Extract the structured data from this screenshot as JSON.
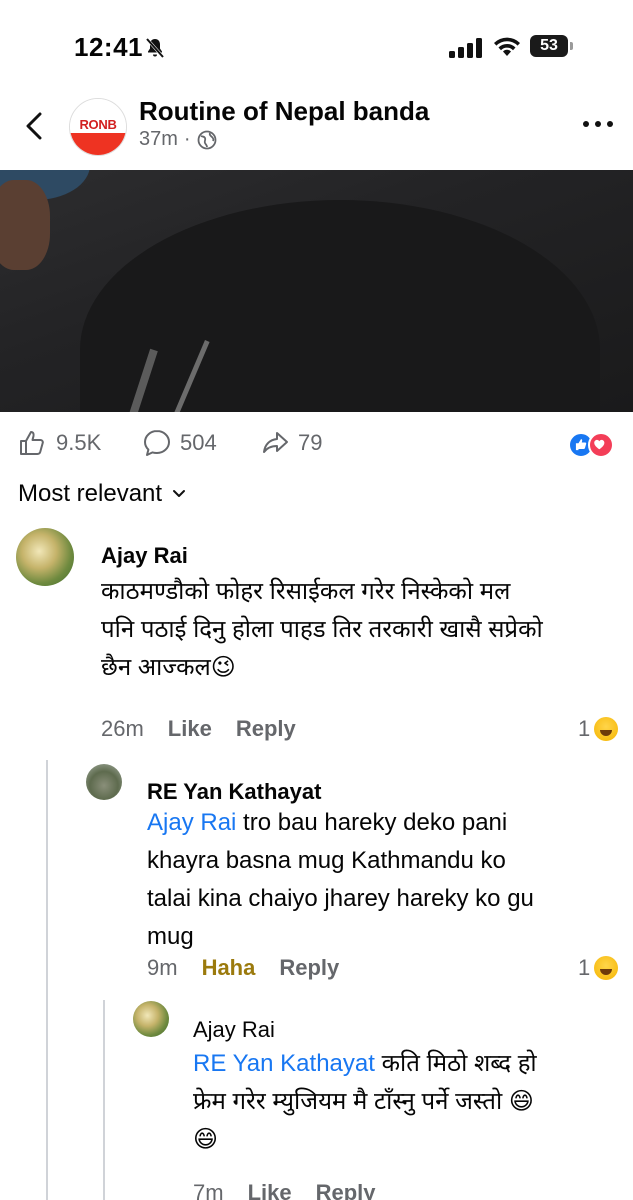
{
  "status_bar": {
    "time": "12:41",
    "battery": "53"
  },
  "header": {
    "title": "Routine of Nepal banda",
    "time_ago": "37m",
    "separator": "·",
    "avatar_text": "RONB"
  },
  "stats": {
    "likes": "9.5K",
    "comments": "504",
    "shares": "79"
  },
  "sort": {
    "label": "Most relevant"
  },
  "comments": [
    {
      "name": "Ajay Rai",
      "lines": [
        "काठमण्डौको फोहर रिसाईकल गरेर निस्केको मल",
        "पनि पठाई दिनु होला पाहड तिर तरकारी खासै सप्रेको",
        "छैन आज्कल😉"
      ],
      "time": "26m",
      "like": "Like",
      "reply": "Reply",
      "reaction_count": "1"
    },
    {
      "name": "RE Yan Kathayat",
      "mention": "Ajay Rai",
      "lines": [
        " tro bau hareky deko pani",
        "khayra basna mug Kathmandu ko",
        "talai kina chaiyo jharey hareky ko gu",
        "mug"
      ],
      "time": "9m",
      "like": "Haha",
      "reply": "Reply",
      "reaction_count": "1"
    },
    {
      "name": "Ajay Rai",
      "mention": "RE Yan Kathayat",
      "lines": [
        " कति मिठो शब्द हो",
        "फ्रेम गरेर म्युजियम मै टाँस्नु पर्ने जस्तो 😄",
        "😄"
      ],
      "time": "7m",
      "like": "Like",
      "reply": "Reply"
    }
  ]
}
